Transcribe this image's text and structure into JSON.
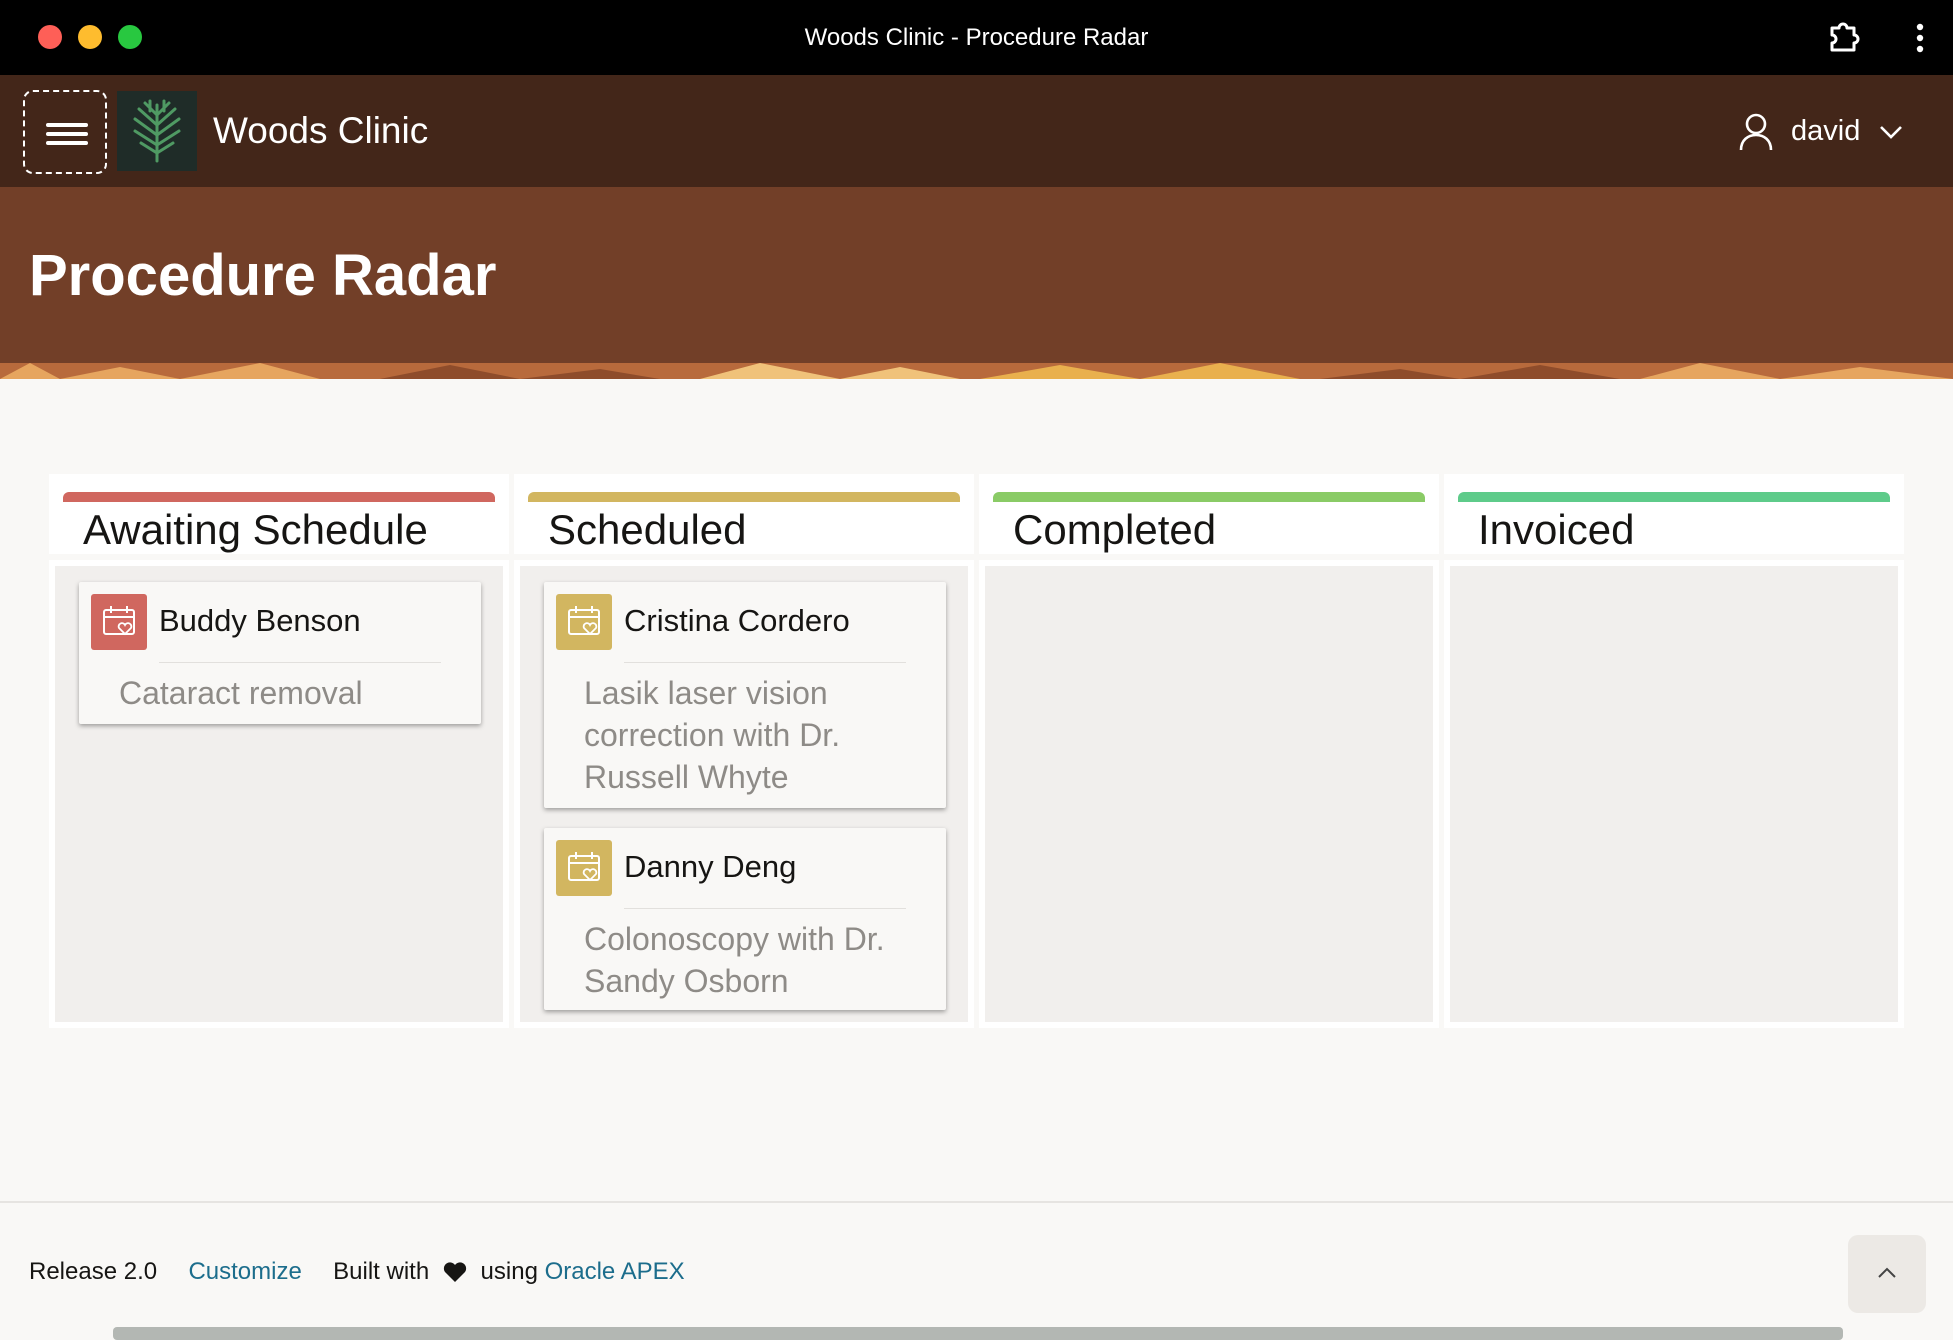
{
  "window": {
    "title": "Woods Clinic - Procedure Radar"
  },
  "header": {
    "brand": "Woods Clinic",
    "user": "david"
  },
  "hero": {
    "title": "Procedure Radar"
  },
  "columns": [
    {
      "title": "Awaiting Schedule",
      "color": "#d0675f"
    },
    {
      "title": "Scheduled",
      "color": "#d2b660"
    },
    {
      "title": "Completed",
      "color": "#8acb66"
    },
    {
      "title": "Invoiced",
      "color": "#5ecb8a"
    }
  ],
  "cards": [
    {
      "name": "Buddy Benson",
      "description": "Cataract removal",
      "icon": "calendar-heart-icon",
      "color": "#d0675f"
    },
    {
      "name": "Cristina Cordero",
      "description": "Lasik laser vision correction with Dr. Russell Whyte",
      "icon": "calendar-heart-icon",
      "color": "#d2b660"
    },
    {
      "name": "Danny Deng",
      "description": "Colonoscopy with Dr. Sandy Osborn",
      "icon": "calendar-heart-icon",
      "color": "#d2b660"
    }
  ],
  "footer": {
    "release": "Release 2.0",
    "customize": "Customize",
    "built_with": "Built with",
    "using": "using",
    "apex": "Oracle APEX"
  }
}
